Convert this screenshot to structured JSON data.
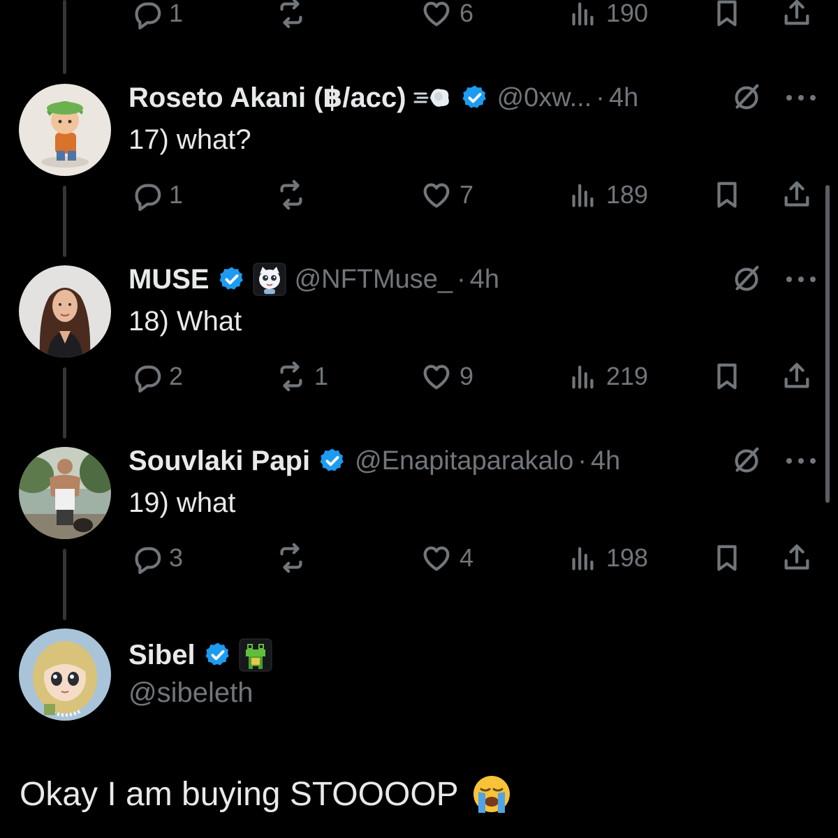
{
  "top_actions": {
    "replies": "1",
    "reposts": "",
    "likes": "6",
    "views": "190"
  },
  "tweets": [
    {
      "name": "Roseto Akani (฿/acc)",
      "name_emoji": "dash-icon",
      "handle": "@0xw...",
      "separator": "·",
      "time": "4h",
      "text": "17) what?",
      "actions": {
        "replies": "1",
        "reposts": "",
        "likes": "7",
        "views": "189"
      }
    },
    {
      "name": "MUSE",
      "name_emoji": "cartoon-avatar-badge",
      "handle": "@NFTMuse_",
      "separator": "·",
      "time": "4h",
      "text": "18) What",
      "actions": {
        "replies": "2",
        "reposts": "1",
        "likes": "9",
        "views": "219"
      }
    },
    {
      "name": "Souvlaki Papi",
      "handle": "@Enapitaparakalo",
      "separator": "·",
      "time": "4h",
      "text": "19) what",
      "actions": {
        "replies": "3",
        "reposts": "",
        "likes": "4",
        "views": "198"
      }
    }
  ],
  "main_tweet": {
    "name": "Sibel",
    "name_emoji": "frog-icon",
    "handle": "@sibeleth",
    "text": "Okay I am buying STOOOOP",
    "text_emoji": "loudly-crying-face-icon"
  },
  "colors": {
    "background": "#000000",
    "text": "#e7e9ea",
    "muted": "#71767b",
    "verified": "#1d9bf0",
    "thread_line": "#333639"
  }
}
